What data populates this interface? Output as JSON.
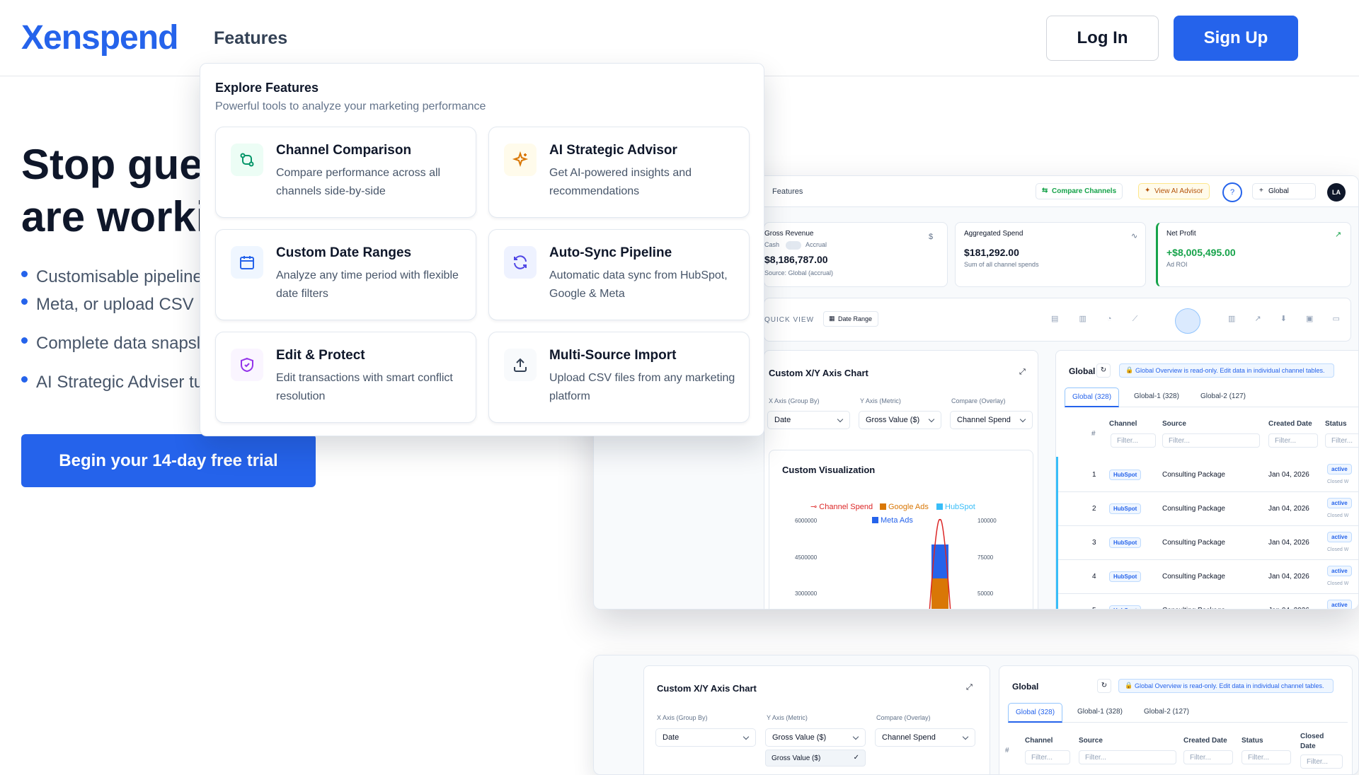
{
  "nav": {
    "logo": "Xenspend",
    "features": "Features",
    "login": "Log In",
    "signup": "Sign Up"
  },
  "hero": {
    "line1": "Stop gue",
    "line2": "are worki",
    "bullets": [
      "Customisable pipeline",
      "Meta, or upload CSV",
      "Complete data snapsl",
      "AI Strategic Adviser tu"
    ],
    "cta": "Begin your 14-day free trial"
  },
  "dropdown": {
    "title": "Explore Features",
    "subtitle": "Powerful tools to analyze your marketing performance",
    "cards": [
      {
        "title": "Channel Comparison",
        "desc": "Compare performance across all channels side-by-side",
        "icon": "git-compare-icon"
      },
      {
        "title": "AI Strategic Advisor",
        "desc": "Get AI-powered insights and recommendations",
        "icon": "sparkles-icon"
      },
      {
        "title": "Custom Date Ranges",
        "desc": "Analyze any time period with flexible date filters",
        "icon": "calendar-icon"
      },
      {
        "title": "Auto-Sync Pipeline",
        "desc": "Automatic data sync from HubSpot, Google & Meta",
        "icon": "refresh-icon"
      },
      {
        "title": "Edit & Protect",
        "desc": "Edit transactions with smart conflict resolution",
        "icon": "shield-check-icon"
      },
      {
        "title": "Multi-Source Import",
        "desc": "Upload CSV files from any marketing platform",
        "icon": "upload-icon"
      }
    ]
  },
  "app": {
    "features": "Features",
    "compare": "Compare Channels",
    "advisor": "View AI Advisor",
    "global": "Global",
    "avatar": "LA",
    "stats": [
      {
        "label": "Gross Revenue",
        "cash": "Cash",
        "accrual": "Accrual",
        "value": "$8,186,787.00",
        "sub": "Source: Global (accrual)",
        "icon": "$"
      },
      {
        "label": "Aggregated Spend",
        "value": "$181,292.00",
        "sub": "Sum of all channel spends"
      },
      {
        "label": "Net Profit",
        "value": "+$8,005,495.00",
        "sub": "Ad ROI"
      }
    ],
    "quickview": "QUICK VIEW",
    "daterange": "Date Range",
    "chart_panel": {
      "title": "Custom X/Y Axis Chart",
      "xlabel": "X Axis (Group By)",
      "ylabel": "Y Axis (Metric)",
      "cmplabel": "Compare (Overlay)",
      "x": "Date",
      "y": "Gross Value ($)",
      "cmp": "Channel Spend",
      "viz": "Custom Visualization"
    },
    "legend": [
      "Channel Spend",
      "Google Ads",
      "HubSpot",
      "Meta Ads"
    ],
    "left_ticks": [
      "6000000",
      "4500000",
      "3000000"
    ],
    "right_ticks": [
      "100000",
      "75000",
      "50000"
    ],
    "table_panel": {
      "title": "Global",
      "notice": "Global Overview is read-only. Edit data in individual channel tables.",
      "tabs": [
        "Global (328)",
        "Global-1 (328)",
        "Global-2 (127)"
      ],
      "cols": [
        "#",
        "Channel",
        "Source",
        "Created Date",
        "Status"
      ],
      "filter": "Filter...",
      "rows": [
        {
          "n": "1",
          "ch": "HubSpot",
          "src": "Consulting Package",
          "date": "Jan 04, 2026",
          "status": "active",
          "sub": "Closed W"
        },
        {
          "n": "2",
          "ch": "HubSpot",
          "src": "Consulting Package",
          "date": "Jan 04, 2026",
          "status": "active",
          "sub": "Closed W"
        },
        {
          "n": "3",
          "ch": "HubSpot",
          "src": "Consulting Package",
          "date": "Jan 04, 2026",
          "status": "active",
          "sub": "Closed W"
        },
        {
          "n": "4",
          "ch": "HubSpot",
          "src": "Consulting Package",
          "date": "Jan 04, 2026",
          "status": "active",
          "sub": "Closed W"
        },
        {
          "n": "5",
          "ch": "HubSpot",
          "src": "Consulting Package",
          "date": "Jan 04, 2026",
          "status": "active",
          "sub": ""
        }
      ]
    },
    "lower": {
      "title": "Custom X/Y Axis Chart",
      "xlabel": "X Axis (Group By)",
      "ylabel": "Y Axis (Metric)",
      "cmplabel": "Compare (Overlay)",
      "x": "Date",
      "y": "Gross Value ($)",
      "cmp": "Channel Spend",
      "option": "Gross Value ($)",
      "table_title": "Global",
      "notice": "Global Overview is read-only. Edit data in individual channel tables.",
      "tabs": [
        "Global (328)",
        "Global-1 (328)",
        "Global-2 (127)"
      ],
      "cols": [
        "#",
        "Channel",
        "Source",
        "Created Date",
        "Status",
        "Closed",
        "Date"
      ],
      "filter": "Filter..."
    }
  },
  "colors": {
    "accent": "#2563eb",
    "profit": "#16a34a",
    "channel_spend": "#dc2626",
    "google": "#d97706",
    "hubspot": "#38bdf8",
    "meta": "#2563eb"
  }
}
